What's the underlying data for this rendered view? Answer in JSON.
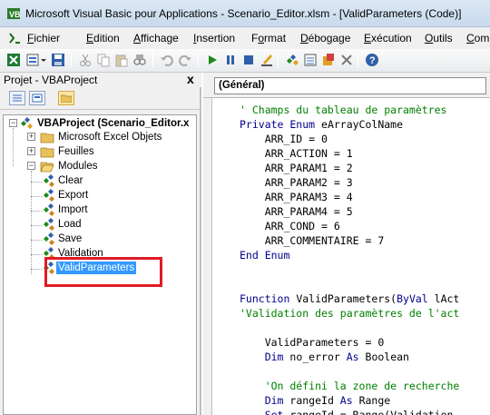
{
  "window": {
    "title": "Microsoft Visual Basic pour Applications - Scenario_Editor.xlsm - [ValidParameters (Code)]"
  },
  "menu": [
    {
      "pre": "",
      "ul": "F",
      "post": "ichier"
    },
    {
      "pre": "",
      "ul": "E",
      "post": "dition"
    },
    {
      "pre": "",
      "ul": "A",
      "post": "ffichage"
    },
    {
      "pre": "",
      "ul": "I",
      "post": "nsertion"
    },
    {
      "pre": "F",
      "ul": "o",
      "post": "rmat"
    },
    {
      "pre": "",
      "ul": "D",
      "post": "ébogage"
    },
    {
      "pre": "",
      "ul": "E",
      "post": "xécution"
    },
    {
      "pre": "",
      "ul": "O",
      "post": "utils"
    },
    {
      "pre": "",
      "ul": "C",
      "post": "om"
    }
  ],
  "project": {
    "panel_title": "Projet - VBAProject",
    "close": "x",
    "root": "VBAProject (Scenario_Editor.x",
    "folders": {
      "excel_objects": "Microsoft Excel Objets",
      "sheets": "Feuilles",
      "modules": "Modules"
    },
    "modules": [
      "Clear",
      "Export",
      "Import",
      "Load",
      "Save",
      "Validation",
      "ValidParameters"
    ],
    "expander_plus": "+",
    "expander_minus": "−"
  },
  "code": {
    "combo_value": "(Général)",
    "lines": [
      {
        "cls": "cm",
        "text": "' Champs du tableau de paramètres"
      },
      {
        "cls": "kw",
        "text": "Private Enum eArrayColName"
      },
      {
        "cls": "tx",
        "text": "    ARR_ID = 0"
      },
      {
        "cls": "tx",
        "text": "    ARR_ACTION = 1"
      },
      {
        "cls": "tx",
        "text": "    ARR_PARAM1 = 2"
      },
      {
        "cls": "tx",
        "text": "    ARR_PARAM2 = 3"
      },
      {
        "cls": "tx",
        "text": "    ARR_PARAM3 = 4"
      },
      {
        "cls": "tx",
        "text": "    ARR_PARAM4 = 5"
      },
      {
        "cls": "tx",
        "text": "    ARR_COND = 6"
      },
      {
        "cls": "tx",
        "text": "    ARR_COMMENTAIRE = 7"
      },
      {
        "cls": "kw",
        "text": "End Enum"
      },
      {
        "cls": "tx",
        "text": ""
      },
      {
        "cls": "tx",
        "text": ""
      },
      {
        "cls": "mix",
        "text": "Function ValidParameters(ByVal lAct"
      },
      {
        "cls": "cm",
        "text": "'Validation des paramètres de l'act"
      },
      {
        "cls": "tx",
        "text": ""
      },
      {
        "cls": "tx",
        "text": "    ValidParameters = 0"
      },
      {
        "cls": "kw",
        "text": "    Dim no_error As Boolean"
      },
      {
        "cls": "tx",
        "text": ""
      },
      {
        "cls": "cm",
        "text": "    'On défini la zone de recherche"
      },
      {
        "cls": "kw",
        "text": "    Dim rangeId As Range"
      },
      {
        "cls": "kw",
        "text": "    Set rangeId = Range(Validation"
      }
    ]
  },
  "colors": {
    "keyword": "#00008b",
    "comment": "#008000",
    "highlight": "#e01b24",
    "selected": "#3399ff"
  }
}
